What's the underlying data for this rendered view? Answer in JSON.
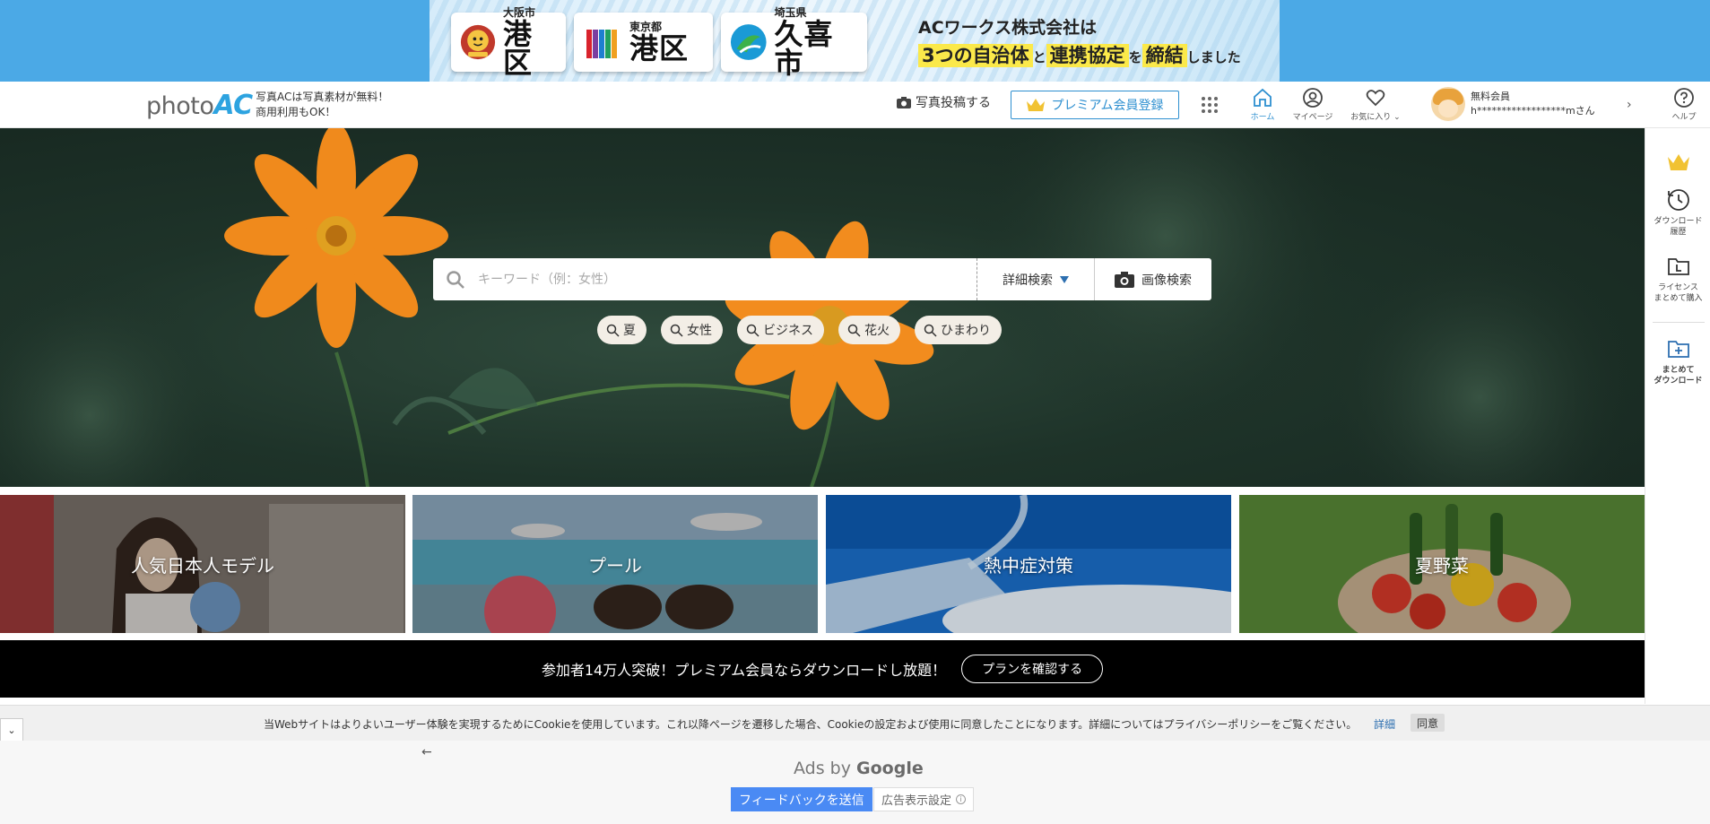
{
  "banner": {
    "municipalities": [
      {
        "pref": "大阪市",
        "name": "港区",
        "emblem": "osaka-minato-mascot-icon"
      },
      {
        "pref": "東京都",
        "name": "港区",
        "emblem": "tokyo-minato-logo-icon"
      },
      {
        "pref": "埼玉県",
        "name": "久喜市",
        "emblem": "kuki-city-logo-icon"
      }
    ],
    "title": "ACワークス株式会社は",
    "sub_highlight_1": "3つの自治体",
    "sub_small_1": "と",
    "sub_highlight_2": "連携協定",
    "sub_small_2": "を",
    "sub_highlight_3": "締結",
    "sub_small_3": "しました"
  },
  "header": {
    "logo_text": "photo",
    "logo_accent": "AC",
    "tagline_line1": "写真ACは写真素材が無料！",
    "tagline_line2": "商用利用もOK！",
    "post_label": "写真投稿する",
    "premium_label": "プレミアム会員登録",
    "nav": {
      "home": "ホーム",
      "mypage": "マイページ",
      "favorites": "お気に入り ⌄"
    },
    "user": {
      "status": "無料会員",
      "name": "h******************mさん"
    },
    "help": "ヘルプ"
  },
  "sidebar": {
    "download_history": [
      "ダウンロード",
      "履歴"
    ],
    "license": [
      "ライセンス",
      "まとめて購入"
    ],
    "bulk_download": [
      "まとめて",
      "ダウンロード"
    ]
  },
  "search": {
    "placeholder": "キーワード（例：女性）",
    "advanced": "詳細検索",
    "image_search": "画像検索",
    "chips": [
      "夏",
      "女性",
      "ビジネス",
      "花火",
      "ひまわり"
    ]
  },
  "tiles": [
    "人気日本人モデル",
    "プール",
    "熱中症対策",
    "夏野菜"
  ],
  "promo": {
    "text": "参加者14万人突破！プレミアム会員ならダウンロードし放題！",
    "button": "プランを確認する"
  },
  "cookie": {
    "toggle": "⌄",
    "text": "当Webサイトはよりよいユーザー体験を実現するためにCookieを使用しています。これ以降ページを遷移した場合、Cookieの設定および使用に同意したことになります。詳細についてはプライバシーポリシーをご覧ください。",
    "detail": "詳細",
    "agree": "同意"
  },
  "ads": {
    "back": "←",
    "ads_by": "Ads by",
    "google": "Google",
    "feedback": "フィードバックを送信",
    "settings": "広告表示設定",
    "info": "i"
  },
  "colors": {
    "banner_bg": "#4ba9e6",
    "accent_blue": "#2d8fd0",
    "highlight_yellow": "#fbe94a",
    "flower_orange": "#f08a1c",
    "feedback_blue": "#4a8af4"
  }
}
